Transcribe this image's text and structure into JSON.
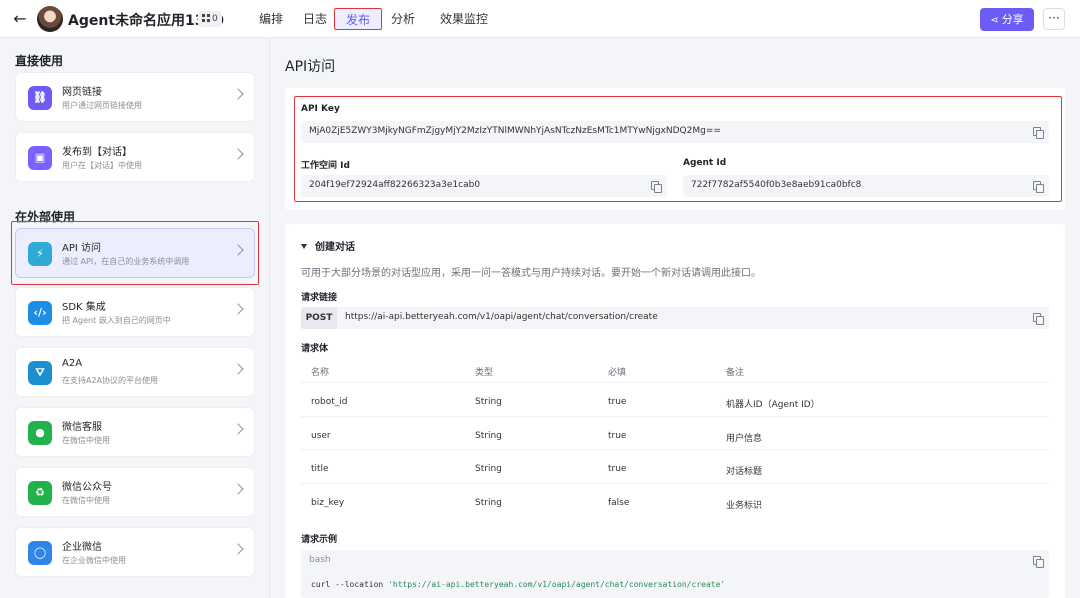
{
  "header": {
    "title": "Agent未命名应用1300",
    "badge_count": "0",
    "tabs": [
      {
        "label": "编排"
      },
      {
        "label": "日志"
      },
      {
        "label": "发布"
      },
      {
        "label": "分析"
      },
      {
        "label": "效果监控"
      }
    ],
    "active_tab": "发布",
    "share_label": "分享",
    "more_label": "···"
  },
  "sidebar": {
    "direct_title": "直接使用",
    "external_title": "在外部使用",
    "items": [
      {
        "title": "网页链接",
        "desc": "用户通过网页链接使用",
        "icon": "link-icon",
        "color": "#6d5bf6"
      },
      {
        "title": "发布到【对话】",
        "desc": "用户在【对话】中使用",
        "icon": "chat-bubbles-icon",
        "color": "#7b61ff"
      },
      {
        "title": "API 访问",
        "desc": "通过 API，在自己的业务系统中调用",
        "icon": "api-plug-icon",
        "color": "#2fa9d6"
      },
      {
        "title": "SDK 集成",
        "desc": "把 Agent 嵌入到自己的网页中",
        "icon": "code-icon",
        "color": "#1c8ee6"
      },
      {
        "title": "A2A",
        "desc": "在支持A2A协议的平台使用",
        "icon": "a2a-icon",
        "color": "#1b8fd0"
      },
      {
        "title": "微信客服",
        "desc": "在微信中使用",
        "icon": "wechat-service-icon",
        "color": "#22b24c"
      },
      {
        "title": "微信公众号",
        "desc": "在微信中使用",
        "icon": "wechat-official-icon",
        "color": "#22b24c"
      },
      {
        "title": "企业微信",
        "desc": "在企业微信中使用",
        "icon": "wecom-icon",
        "color": "#2f86e8"
      }
    ]
  },
  "main": {
    "title": "API访问",
    "api_key_label": "API Key",
    "api_key_value": "MjA0ZjE5ZWY3MjkyNGFmZjgyMjY2MzIzYTNlMWNhYjAsNTczNzEsMTc1MTYwNjgxNDQ2Mg==",
    "workspace_label": "工作空间 Id",
    "workspace_value": "204f19ef72924aff82266323a3e1cab0",
    "agent_label": "Agent Id",
    "agent_value": "722f7782af5540f0b3e8aeb91ca0bfc8",
    "section_title": "创建对话",
    "section_desc": "可用于大部分场景的对话型应用，采用一问一答模式与用户持续对话。要开始一个新对话请调用此接口。",
    "request_url_label": "请求链接",
    "method": "POST",
    "url": "https://ai-api.betteryeah.com/v1/oapi/agent/chat/conversation/create",
    "request_body_label": "请求体",
    "table_headers": [
      "名称",
      "类型",
      "必填",
      "备注"
    ],
    "table_rows": [
      [
        "robot_id",
        "String",
        "true",
        "机器人ID（Agent ID）"
      ],
      [
        "user",
        "String",
        "true",
        "用户信息"
      ],
      [
        "title",
        "String",
        "true",
        "对话标题"
      ],
      [
        "biz_key",
        "String",
        "false",
        "业务标识"
      ]
    ],
    "example_label": "请求示例",
    "code_lang": "bash",
    "code_prefix": "curl --location ",
    "code_url": "'https://ai-api.betteryeah.com/v1/oapi/agent/chat/conversation/create'"
  }
}
